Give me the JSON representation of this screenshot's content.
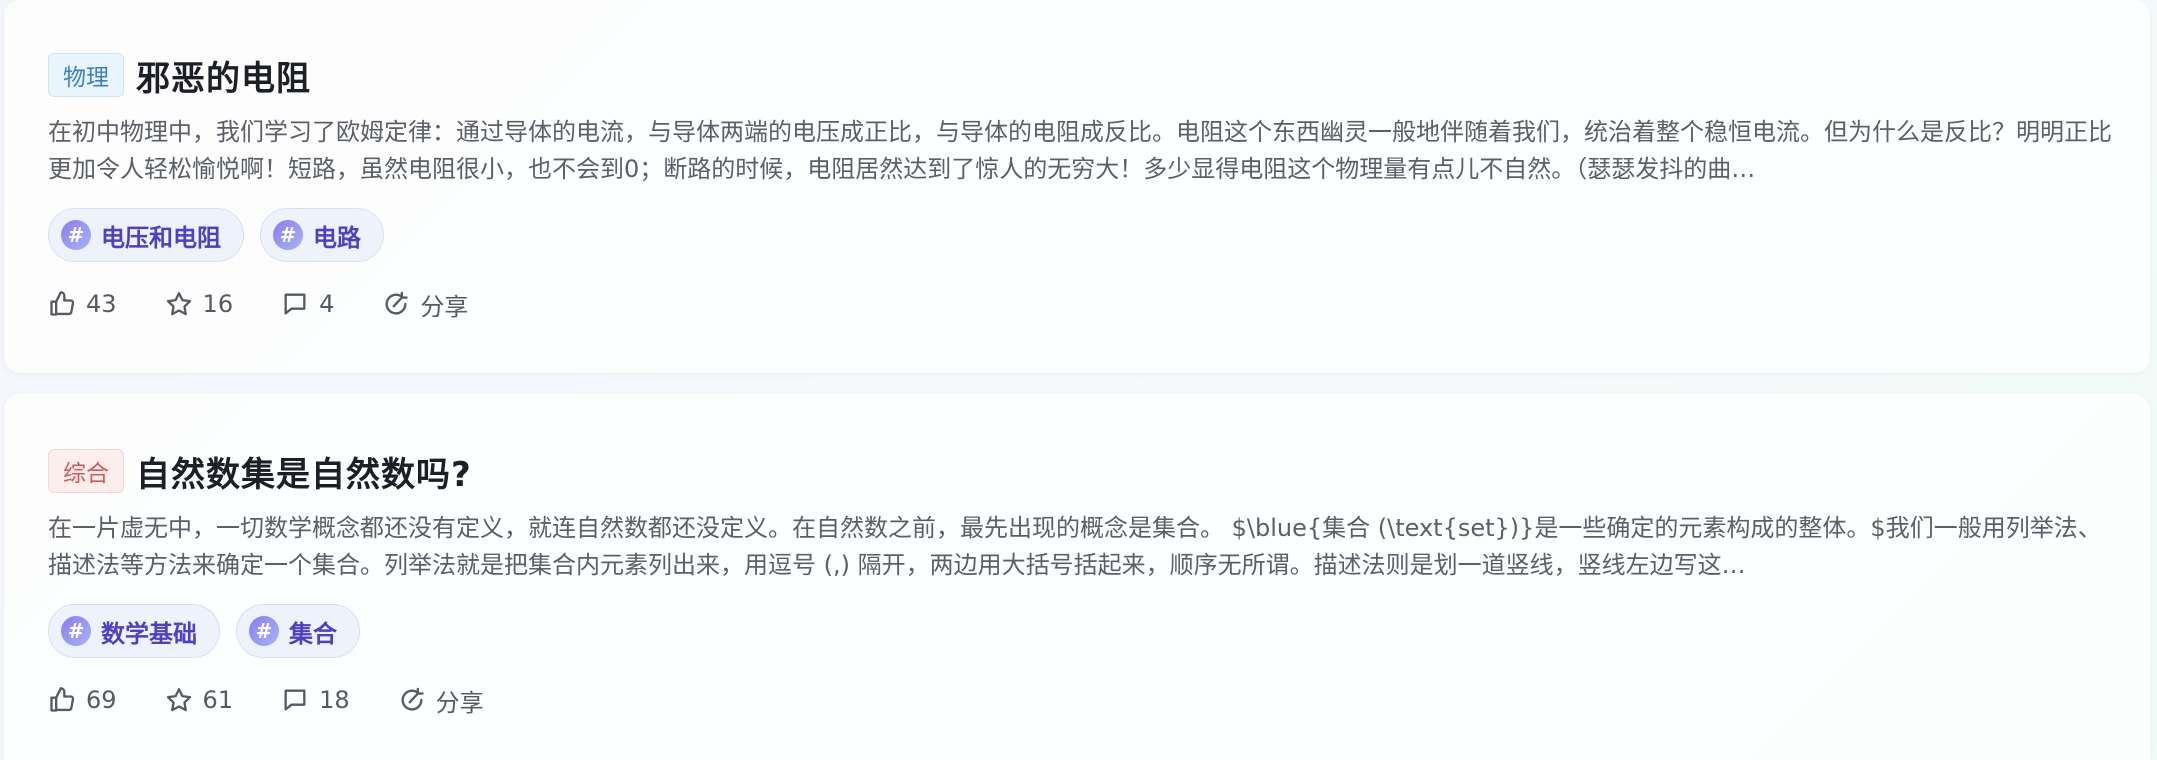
{
  "posts": [
    {
      "subject": "物理",
      "title": "邪恶的电阻",
      "excerpt": "在初中物理中，我们学习了欧姆定律：通过导体的电流，与导体两端的电压成正比，与导体的电阻成反比。电阻这个东西幽灵一般地伴随着我们，统治着整个稳恒电流。但为什么是反比？明明正比更加令人轻松愉悦啊！短路，虽然电阻很小，也不会到0；断路的时候，电阻居然达到了惊人的无穷大！多少显得电阻这个物理量有点儿不自然。（瑟瑟发抖的曲…",
      "tags": [
        "电压和电阻",
        "电路"
      ],
      "likes": "43",
      "stars": "16",
      "comments": "4",
      "share_label": "分享"
    },
    {
      "subject": "综合",
      "title": "自然数集是自然数吗?",
      "excerpt": "在一片虚无中，一切数学概念都还没有定义，就连自然数都还没定义。在自然数之前，最先出现的概念是集合。           $\\blue{集合 (\\text{set})}是一些确定的元素构成的整体。$我们一般用列举法、描述法等方法来确定一个集合。列举法就是把集合内元素列出来，用逗号 (,) 隔开，两边用大括号括起来，顺序无所谓。描述法则是划一道竖线，竖线左边写这…",
      "tags": [
        "数学基础",
        "集合"
      ],
      "likes": "69",
      "stars": "61",
      "comments": "18",
      "share_label": "分享"
    }
  ],
  "tag_symbol": "#",
  "colors": {
    "physics_badge": "#3a7fc4",
    "general_badge": "#d05a5a",
    "tag_text": "#4f3fc4"
  }
}
